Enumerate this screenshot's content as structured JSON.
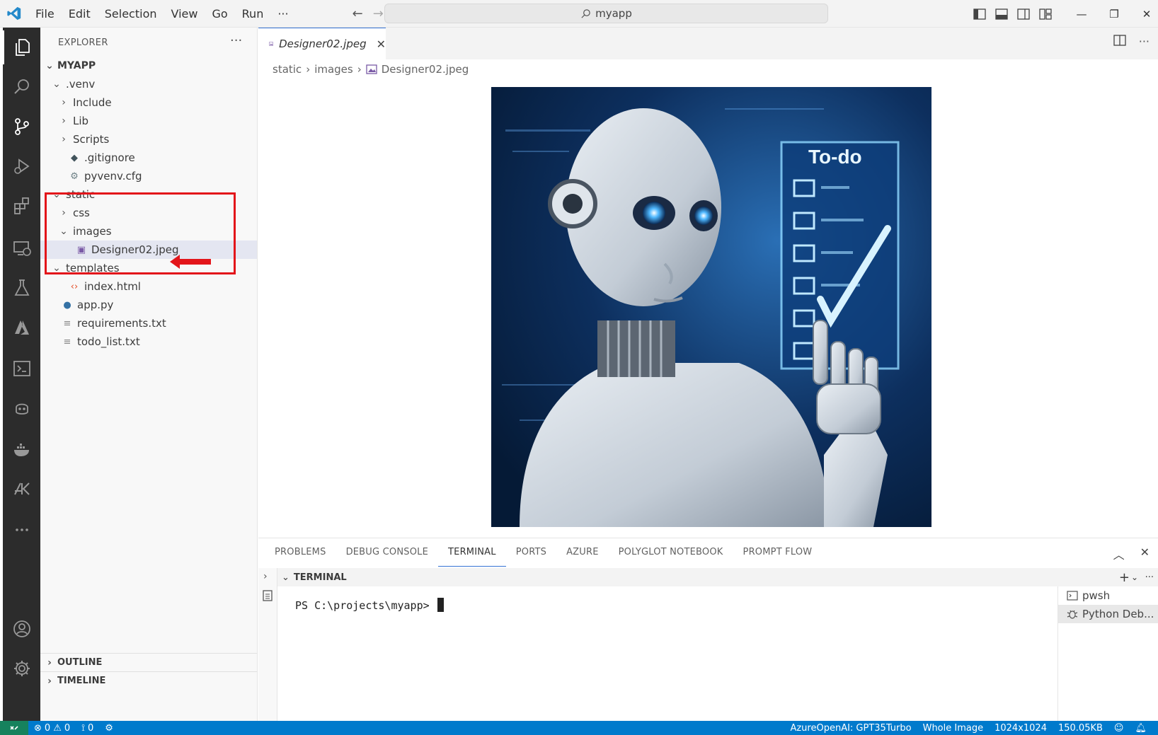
{
  "titlebar": {
    "menu": [
      "File",
      "Edit",
      "Selection",
      "View",
      "Go",
      "Run"
    ],
    "more": "···",
    "search": "myapp",
    "window_controls": [
      "—",
      "❐",
      "✕"
    ]
  },
  "sidebar": {
    "title": "EXPLORER",
    "more": "···",
    "root": "MYAPP",
    "tree": [
      {
        "label": ".venv",
        "depth": 1,
        "chevron": "down",
        "icon": ""
      },
      {
        "label": "Include",
        "depth": 2,
        "chevron": "right",
        "icon": ""
      },
      {
        "label": "Lib",
        "depth": 2,
        "chevron": "right",
        "icon": ""
      },
      {
        "label": "Scripts",
        "depth": 2,
        "chevron": "right",
        "icon": ""
      },
      {
        "label": ".gitignore",
        "depth": 2,
        "chevron": "",
        "icon": "git-icon"
      },
      {
        "label": "pyvenv.cfg",
        "depth": 2,
        "chevron": "",
        "icon": "gear-icon"
      },
      {
        "label": "static",
        "depth": 1,
        "chevron": "down",
        "icon": ""
      },
      {
        "label": "css",
        "depth": 2,
        "chevron": "right",
        "icon": ""
      },
      {
        "label": "images",
        "depth": 2,
        "chevron": "down",
        "icon": ""
      },
      {
        "label": "Designer02.jpeg",
        "depth": 3,
        "chevron": "",
        "icon": "image-file-icon",
        "selected": true
      },
      {
        "label": "templates",
        "depth": 1,
        "chevron": "down",
        "icon": ""
      },
      {
        "label": "index.html",
        "depth": 2,
        "chevron": "",
        "icon": "html-icon"
      },
      {
        "label": "app.py",
        "depth": 1,
        "chevron": "",
        "icon": "python-icon"
      },
      {
        "label": "requirements.txt",
        "depth": 1,
        "chevron": "",
        "icon": "text-file-icon"
      },
      {
        "label": "todo_list.txt",
        "depth": 1,
        "chevron": "",
        "icon": "text-file-icon"
      }
    ],
    "outline": "OUTLINE",
    "timeline": "TIMELINE"
  },
  "editor": {
    "tab_label": "Designer02.jpeg",
    "breadcrumb": [
      "static",
      "images",
      "Designer02.jpeg"
    ],
    "image_text": "To-do"
  },
  "panel": {
    "tabs": [
      "PROBLEMS",
      "DEBUG CONSOLE",
      "TERMINAL",
      "PORTS",
      "AZURE",
      "POLYGLOT NOTEBOOK",
      "PROMPT FLOW"
    ],
    "active_tab": "TERMINAL",
    "terminal_header": "TERMINAL",
    "prompt": "PS C:\\projects\\myapp>",
    "terminals": [
      "pwsh",
      "Python Deb..."
    ]
  },
  "statusbar": {
    "errors": "0",
    "warnings": "0",
    "ports": "0",
    "azure_openai": "AzureOpenAI: GPT35Turbo",
    "zoom": "Whole Image",
    "dimensions": "1024x1024",
    "size": "150.05KB"
  },
  "colors": {
    "accent": "#007acc",
    "highlight": "#e3151a",
    "activity_bar": "#2c2c2c"
  }
}
